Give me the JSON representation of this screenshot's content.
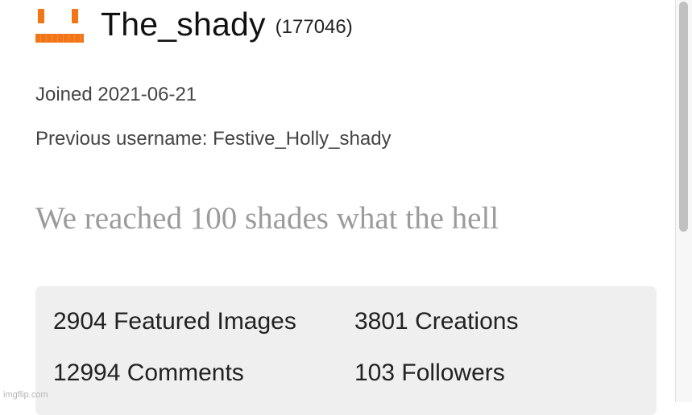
{
  "profile": {
    "username": "The_shady",
    "points": "(177046)",
    "joined": "Joined 2021-06-21",
    "previous_username": "Previous username: Festive_Holly_shady",
    "bio": "We reached 100 shades what the hell"
  },
  "stats": {
    "featured_images": "2904 Featured Images",
    "creations": "3801 Creations",
    "comments": "12994 Comments",
    "followers": "103 Followers"
  },
  "watermark": "imgflip.com",
  "colors": {
    "avatar": "#f27618",
    "bio_text": "#9b9b9b",
    "stats_background": "#efefef"
  },
  "icons": {
    "avatar": "orange-pixel-face-icon"
  }
}
